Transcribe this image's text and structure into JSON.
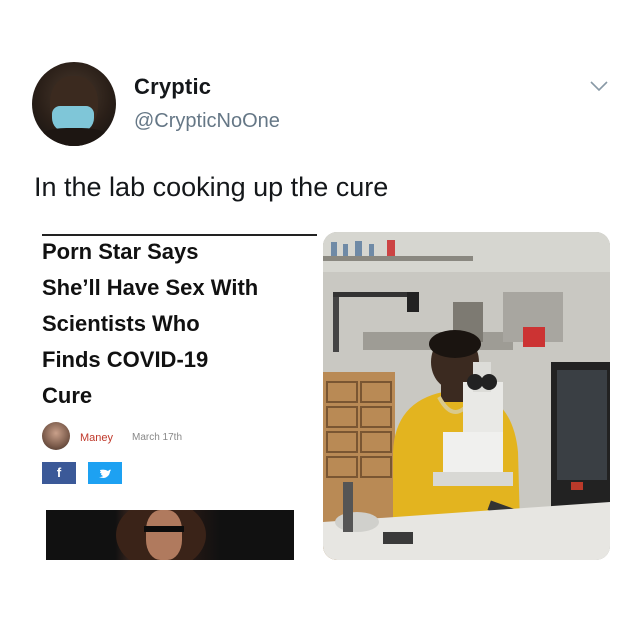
{
  "tweet": {
    "display_name": "Cryptic",
    "handle": "@CrypticNoOne",
    "text": "In the lab cooking up the cure"
  },
  "article": {
    "headline": "Porn Star Says\nShe’ll Have Sex With\nScientists Who\nFinds COVID-19\nCure",
    "author": "Maney",
    "date": "March 17th",
    "facebook_label": "f",
    "facebook_color": "#3b5998",
    "twitter_color": "#1da1f2"
  },
  "icons": {
    "menu": "chevron-down-icon",
    "facebook": "facebook-icon",
    "twitter": "twitter-icon"
  }
}
